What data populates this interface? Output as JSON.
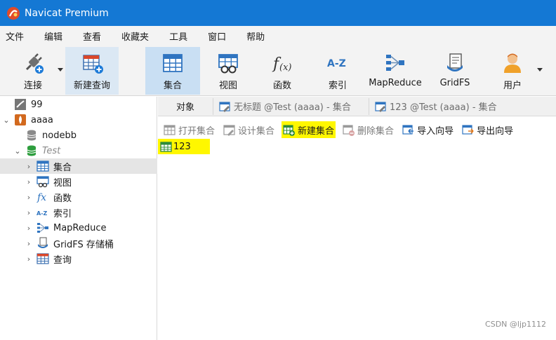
{
  "window": {
    "title": "Navicat Premium"
  },
  "menu": [
    "文件",
    "编辑",
    "查看",
    "收藏夹",
    "工具",
    "窗口",
    "帮助"
  ],
  "toolbar": {
    "connect": "连接",
    "new_query": "新建查询",
    "collection": "集合",
    "view": "视图",
    "function": "函数",
    "index": "索引",
    "mapreduce": "MapReduce",
    "gridfs": "GridFS",
    "user": "用户"
  },
  "sidebar": {
    "items": [
      {
        "label": "99"
      },
      {
        "label": "aaaa"
      },
      {
        "label": "nodebb"
      },
      {
        "label": "Test"
      },
      {
        "label": "集合"
      },
      {
        "label": "视图"
      },
      {
        "label": "函数"
      },
      {
        "label": "索引"
      },
      {
        "label": "MapReduce"
      },
      {
        "label": "GridFS 存储桶"
      },
      {
        "label": "查询"
      }
    ]
  },
  "tabs": {
    "objects": "对象",
    "tab1": "无标题 @Test (aaaa) - 集合",
    "tab2": "123 @Test (aaaa) - 集合"
  },
  "objbar": {
    "open": "打开集合",
    "design": "设计集合",
    "new": "新建集合",
    "delete": "删除集合",
    "import": "导入向导",
    "export": "导出向导"
  },
  "content": {
    "items": [
      "123"
    ]
  },
  "watermark": "CSDN @ljp1112",
  "colors": {
    "titlebar": "#1478d4",
    "highlight": "#fff700",
    "selected": "#c9dff3"
  }
}
